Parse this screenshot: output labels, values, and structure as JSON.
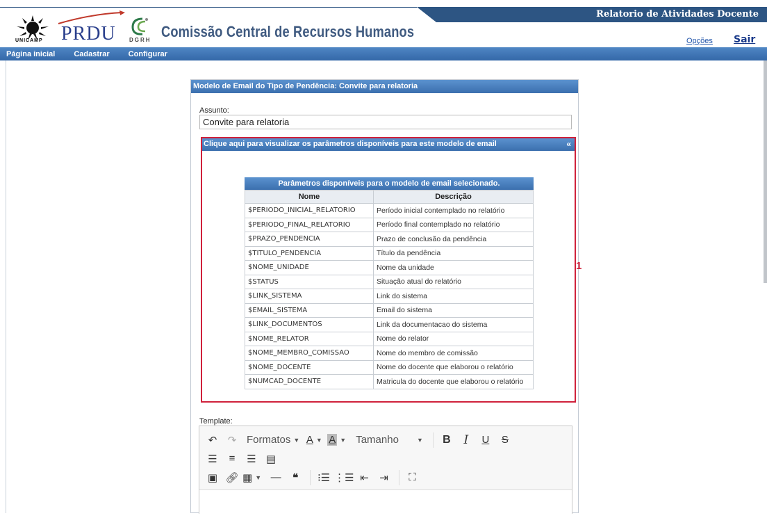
{
  "header": {
    "system_title": "Relatorio de Atividades Docente",
    "org_title": "Comissão Central de Recursos Humanos",
    "logo_unicamp": "UNICAMP",
    "logo_prdu": "PRDU",
    "logo_dgrh": "DGRH",
    "options_link": "Opções",
    "logout_link": "Sair"
  },
  "nav": {
    "items": [
      "Página inicial",
      "Cadastrar",
      "Configurar"
    ]
  },
  "panel": {
    "title": "Modelo de Email do Tipo de Pendência: Convite para relatoria",
    "subject_label": "Assunto:",
    "subject_value": "Convite para relatoria",
    "params_toggle": "Clique aqui para visualizar os parâmetros disponíveis para este modelo de email",
    "params_toggle_icon": "«",
    "annotation": "1",
    "template_label": "Template:"
  },
  "params_table": {
    "caption": "Parâmetros disponíveis para o modelo de email selecionado.",
    "headers": [
      "Nome",
      "Descrição"
    ],
    "rows": [
      [
        "$PERIODO_INICIAL_RELATORIO",
        "Período inicial contemplado no relatório"
      ],
      [
        "$PERIODO_FINAL_RELATORIO",
        "Período final contemplado no relatório"
      ],
      [
        "$PRAZO_PENDENCIA",
        "Prazo de conclusão da pendência"
      ],
      [
        "$TITULO_PENDENCIA",
        "Título da pendência"
      ],
      [
        "$NOME_UNIDADE",
        "Nome da unidade"
      ],
      [
        "$STATUS",
        "Situação atual do relatório"
      ],
      [
        "$LINK_SISTEMA",
        "Link do sistema"
      ],
      [
        "$EMAIL_SISTEMA",
        "Email do sistema"
      ],
      [
        "$LINK_DOCUMENTOS",
        "Link da documentacao do sistema"
      ],
      [
        "$NOME_RELATOR",
        "Nome do relator"
      ],
      [
        "$NOME_MEMBRO_COMISSAO",
        "Nome do membro de comissão"
      ],
      [
        "$NOME_DOCENTE",
        "Nome do docente que elaborou o relatório"
      ],
      [
        "$NUMCAD_DOCENTE",
        "Matricula do docente que elaborou o relatório"
      ]
    ]
  },
  "editor": {
    "formats_label": "Formatos",
    "size_label": "Tamanho",
    "font_color_label": "A",
    "bg_color_label": "A",
    "bold_label": "B",
    "italic_label": "I",
    "underline_label": "U",
    "strike_label": "S",
    "icons": [
      "undo-icon",
      "redo-icon",
      "align-left-icon",
      "align-center-icon",
      "align-right-icon",
      "align-justify-icon",
      "image-icon",
      "link-icon",
      "table-icon",
      "horizontal-rule-icon",
      "blockquote-icon",
      "bullet-list-icon",
      "numbered-list-icon",
      "outdent-icon",
      "indent-icon",
      "fullscreen-icon"
    ]
  },
  "colors": {
    "header_band": "#2d5583",
    "nav_bar": "#3f76b8",
    "panel_header": "#4a80c0",
    "annotation_red": "#d0213b",
    "org_title": "#3f5a80"
  }
}
